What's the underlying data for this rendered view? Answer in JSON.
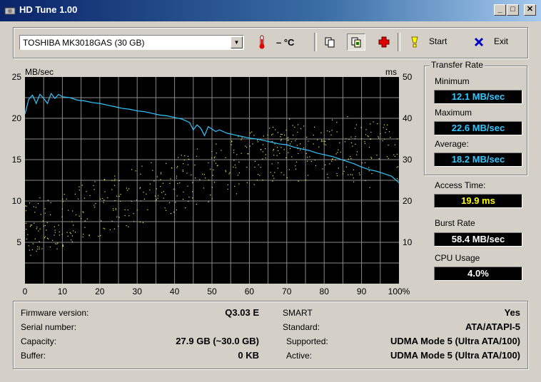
{
  "window": {
    "title": "HD Tune 1.00"
  },
  "toolbar": {
    "drive": "TOSHIBA MK3018GAS (30 GB)",
    "temperature": "– °C",
    "start_label": "Start",
    "exit_label": "Exit"
  },
  "chart_data": {
    "type": "line",
    "y_left_label": "MB/sec",
    "y_right_label": "ms",
    "x_ticks": [
      "0",
      "10",
      "20",
      "30",
      "40",
      "50",
      "60",
      "70",
      "80",
      "90",
      "100%"
    ],
    "y_left_ticks": [
      "5",
      "10",
      "15",
      "20",
      "25"
    ],
    "y_right_ticks": [
      "10",
      "20",
      "30",
      "40",
      "50"
    ],
    "x_range": [
      0,
      100
    ],
    "y_left_range": [
      0,
      25
    ],
    "y_right_range": [
      0,
      50
    ],
    "grid": true,
    "series": [
      {
        "color": "#30c8ff",
        "x": [
          0,
          1,
          2,
          3,
          4,
          5,
          6,
          7,
          8,
          9,
          10,
          12,
          14,
          16,
          18,
          20,
          22,
          24,
          26,
          28,
          30,
          32,
          34,
          36,
          38,
          40,
          42,
          44,
          45,
          46,
          47,
          48,
          49,
          50,
          51,
          52,
          54,
          56,
          58,
          60,
          62,
          64,
          66,
          68,
          70,
          72,
          74,
          76,
          78,
          80,
          82,
          84,
          86,
          88,
          90,
          92,
          94,
          96,
          98,
          100
        ],
        "y": [
          20.5,
          22.3,
          22.8,
          21.8,
          22.9,
          22.4,
          21.8,
          23.0,
          22.4,
          22.9,
          22.6,
          22.5,
          22.2,
          22.1,
          21.9,
          21.8,
          21.6,
          21.4,
          21.2,
          21.1,
          20.9,
          20.8,
          20.6,
          20.4,
          20.3,
          20.1,
          19.9,
          19.5,
          18.6,
          19.2,
          18.8,
          17.9,
          19.0,
          18.7,
          18.4,
          18.6,
          18.2,
          18.0,
          17.8,
          17.6,
          17.5,
          17.3,
          17.1,
          16.9,
          16.8,
          16.5,
          16.3,
          16.1,
          15.8,
          15.6,
          15.4,
          15.1,
          14.8,
          14.5,
          14.1,
          13.8,
          13.6,
          13.3,
          13.0,
          12.2
        ]
      }
    ]
  },
  "transfer_rate": {
    "title": "Transfer Rate",
    "minimum_label": "Minimum",
    "minimum": "12.1 MB/sec",
    "maximum_label": "Maximum",
    "maximum": "22.6 MB/sec",
    "average_label": "Average:",
    "average": "18.2 MB/sec"
  },
  "access_time": {
    "label": "Access Time:",
    "value": "19.9 ms"
  },
  "burst_rate": {
    "label": "Burst Rate",
    "value": "58.4 MB/sec"
  },
  "cpu_usage": {
    "label": "CPU Usage",
    "value": "4.0%"
  },
  "info": {
    "firmware_label": "Firmware version:",
    "firmware": "Q3.03 E",
    "serial_label": "Serial number:",
    "serial": "",
    "capacity_label": "Capacity:",
    "capacity": "27.9 GB (~30.0 GB)",
    "buffer_label": "Buffer:",
    "buffer": "0 KB",
    "smart_label": "SMART",
    "smart": "Yes",
    "standard_label": "Standard:",
    "standard": "ATA/ATAPI-5",
    "supported_label": "Supported:",
    "supported": "UDMA Mode 5 (Ultra ATA/100)",
    "active_label": "Active:",
    "active": "UDMA Mode 5 (Ultra ATA/100)"
  }
}
